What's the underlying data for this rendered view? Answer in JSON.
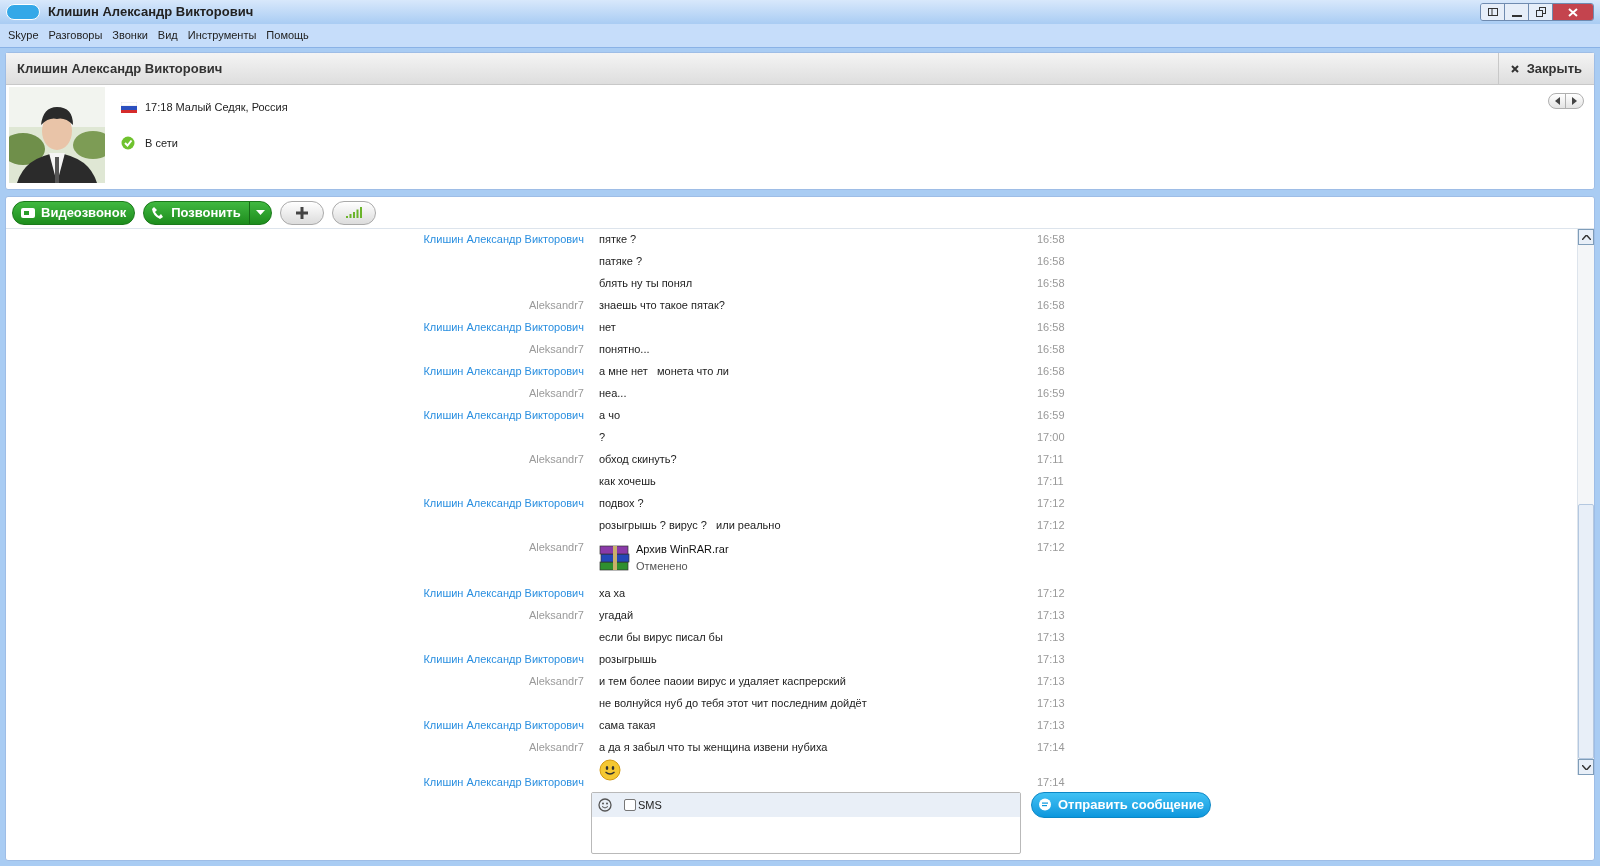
{
  "window": {
    "title": "Клишин Александр Викторович"
  },
  "menu": [
    "Skype",
    "Разговоры",
    "Звонки",
    "Вид",
    "Инструменты",
    "Помощь"
  ],
  "header": {
    "title": "Клишин Александр Викторович",
    "close": "Закрыть"
  },
  "profile": {
    "location": "17:18 Малый Седяк, Россия",
    "status": "В сети"
  },
  "toolbar": {
    "video_call": "Видеозвонок",
    "call": "Позвонить"
  },
  "messages": [
    {
      "sender": "Клишин Александр Викторович",
      "color": "#2a8fe0",
      "kind": "text",
      "text": "пятке ?",
      "time": "16:58"
    },
    {
      "kind": "text",
      "text": "патяке ?",
      "time": "16:58"
    },
    {
      "kind": "text",
      "text": "блять ну ты понял",
      "time": "16:58"
    },
    {
      "sender": "Aleksandr7",
      "color": "#9a9a9a",
      "kind": "text",
      "text": "знаешь что такое пятак?",
      "time": "16:58"
    },
    {
      "sender": "Клишин Александр Викторович",
      "color": "#2a8fe0",
      "kind": "text",
      "text": "нет",
      "time": "16:58"
    },
    {
      "sender": "Aleksandr7",
      "color": "#9a9a9a",
      "kind": "text",
      "text": "понятно...",
      "time": "16:58"
    },
    {
      "sender": "Клишин Александр Викторович",
      "color": "#2a8fe0",
      "kind": "text",
      "text": "а мне нет   монета что ли",
      "time": "16:58"
    },
    {
      "sender": "Aleksandr7",
      "color": "#9a9a9a",
      "kind": "text",
      "text": "неа...",
      "time": "16:59"
    },
    {
      "sender": "Клишин Александр Викторович",
      "color": "#2a8fe0",
      "kind": "text",
      "text": "а чо",
      "time": "16:59"
    },
    {
      "kind": "text",
      "text": "?",
      "time": "17:00"
    },
    {
      "sender": "Aleksandr7",
      "color": "#9a9a9a",
      "kind": "text",
      "text": "обход скинуть?",
      "time": "17:11"
    },
    {
      "kind": "text",
      "text": "как хочешь",
      "time": "17:11"
    },
    {
      "sender": "Клишин Александр Викторович",
      "color": "#2a8fe0",
      "kind": "text",
      "text": "подвох ?",
      "time": "17:12"
    },
    {
      "kind": "text",
      "text": "розыгрышь ? вирус ?   или реально",
      "time": "17:12"
    },
    {
      "sender": "Aleksandr7",
      "color": "#9a9a9a",
      "kind": "file",
      "text": "Архив WinRAR.rar",
      "note": "Отменено",
      "time": "17:12"
    },
    {
      "sender": "Клишин Александр Викторович",
      "color": "#2a8fe0",
      "kind": "text",
      "text": "ха ха",
      "time": "17:12"
    },
    {
      "sender": "Aleksandr7",
      "color": "#9a9a9a",
      "kind": "text",
      "text": "угадай",
      "time": "17:13"
    },
    {
      "kind": "text",
      "text": "если бы вирус писал бы",
      "time": "17:13"
    },
    {
      "sender": "Клишин Александр Викторович",
      "color": "#2a8fe0",
      "kind": "text",
      "text": "розыгрышь",
      "time": "17:13"
    },
    {
      "sender": "Aleksandr7",
      "color": "#9a9a9a",
      "kind": "text",
      "text": "и тем более паоии вирус и удаляет каспрерский",
      "time": "17:13"
    },
    {
      "kind": "text",
      "text": "не волнуйся нуб до тебя этот чит последним дойдёт",
      "time": "17:13"
    },
    {
      "sender": "Клишин Александр Викторович",
      "color": "#2a8fe0",
      "kind": "text",
      "text": "сама такая",
      "time": "17:13"
    },
    {
      "sender": "Aleksandr7",
      "color": "#9a9a9a",
      "kind": "text",
      "text": "а да я забыл что ты женщина извени нубиха",
      "time": "17:14"
    },
    {
      "sender": "Клишин Александр Викторович",
      "color": "#2a8fe0",
      "kind": "emoji",
      "time": "17:14"
    }
  ],
  "composer": {
    "sms_label": "SMS",
    "sms_checked": false,
    "send": "Отправить сообщение"
  }
}
